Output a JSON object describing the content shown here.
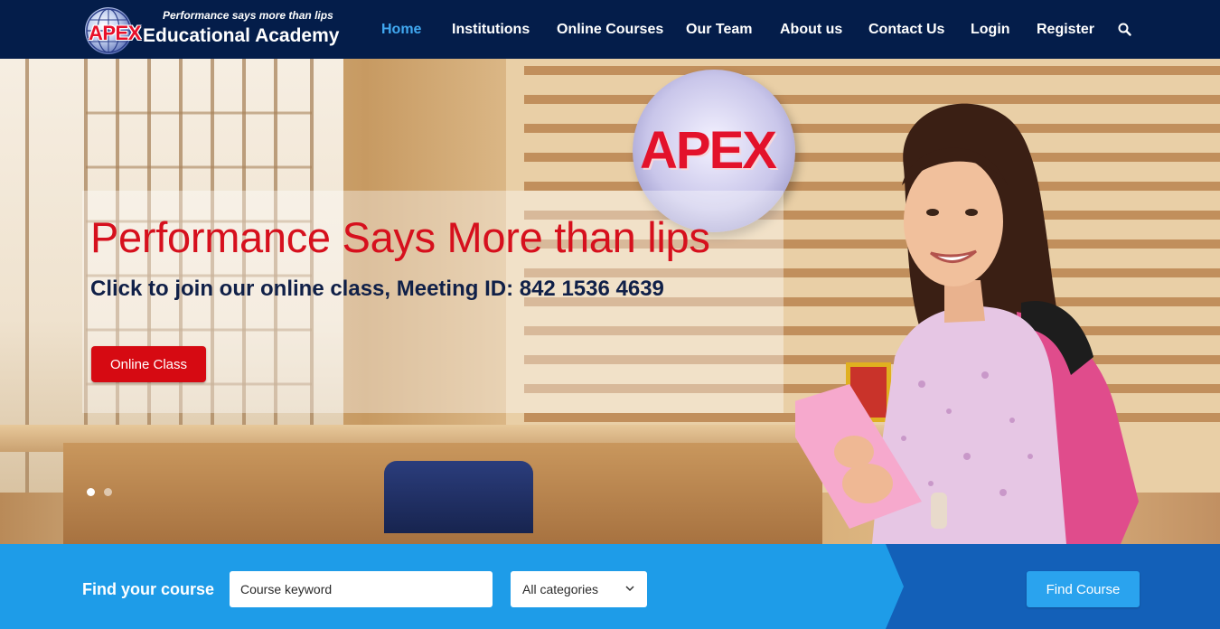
{
  "brand": {
    "logo_mark": "APEX",
    "name": "Educational Academy",
    "tagline": "Performance says more than lips"
  },
  "nav": {
    "items": [
      {
        "label": "Home",
        "active": true
      },
      {
        "label": "Institutions",
        "active": false
      },
      {
        "label": "Online Courses",
        "active": false
      },
      {
        "label": "Our Team",
        "active": false
      },
      {
        "label": "About us",
        "active": false
      },
      {
        "label": "Contact Us",
        "active": false
      },
      {
        "label": "Login",
        "active": false
      },
      {
        "label": "Register",
        "active": false
      }
    ],
    "search_icon": "search-icon"
  },
  "hero": {
    "wall_logo_text": "APEX",
    "headline": "Performance Says More than lips",
    "subline": "Click to join our online class, Meeting ID: 842 1536 4639",
    "button_label": "Online Class",
    "slides": 2,
    "active_slide": 1
  },
  "finder": {
    "label": "Find your course",
    "keyword_placeholder": "Course keyword",
    "keyword_value": "",
    "category_selected": "All categories",
    "button_label": "Find Course"
  },
  "colors": {
    "nav_bg": "#041d4a",
    "nav_active": "#41a8f0",
    "headline_red": "#d6101d",
    "button_red": "#d60a12",
    "finder_blue": "#1e9ce8",
    "finder_dark_blue": "#1360b8"
  }
}
